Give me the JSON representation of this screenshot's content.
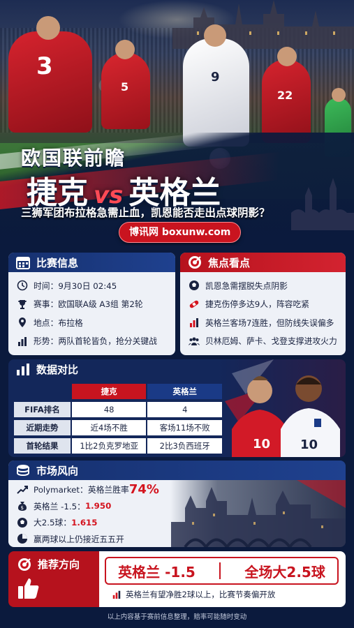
{
  "hero": {
    "kicker": "欧国联前瞻",
    "team_home": "捷克",
    "vs": "vs",
    "team_away": "英格兰",
    "tagline": "三狮军团布拉格急需止血，凯恩能否走出点球阴影？",
    "brand": "博讯网  boxunw.com",
    "jersey_numbers": [
      "3",
      "5",
      "9",
      "22",
      "10",
      "10"
    ]
  },
  "match_info": {
    "title": "比赛信息",
    "rows": [
      {
        "icon": "clock-icon",
        "label": "时间：",
        "value": "9月30日 02:45"
      },
      {
        "icon": "trophy-icon",
        "label": "赛事：",
        "value": "欧国联A级  A3组  第2轮"
      },
      {
        "icon": "location-pin-icon",
        "label": "地点：",
        "value": "布拉格"
      },
      {
        "icon": "bar-chart-icon",
        "label": "形势：",
        "value": "两队首轮皆负，抢分关键战"
      }
    ]
  },
  "focus": {
    "title": "焦点看点",
    "rows": [
      {
        "icon": "soccer-ball-icon",
        "text": "凯恩急需摆脱失点阴影"
      },
      {
        "icon": "bandage-icon",
        "text": "捷克伤停多达9人，阵容吃紧"
      },
      {
        "icon": "trend-bars-icon",
        "text": "英格兰客场7连胜，但防线失误偏多"
      },
      {
        "icon": "team-icon",
        "text": "贝林厄姆、萨卡、戈登支撑进攻火力"
      }
    ]
  },
  "compare": {
    "title": "数据对比",
    "headers": [
      "",
      "捷克",
      "英格兰"
    ],
    "rows": [
      [
        "FIFA排名",
        "48",
        "4"
      ],
      [
        "近期走势",
        "近4场不胜",
        "客场11场不败"
      ],
      [
        "首轮结果",
        "1比2负克罗地亚",
        "2比3负西班牙"
      ]
    ]
  },
  "market": {
    "title": "市场风向",
    "rows": [
      {
        "icon": "trend-line-icon",
        "text": "Polymarket：英格兰胜率 ",
        "highlight": "74%"
      },
      {
        "icon": "money-bag-icon",
        "text": "英格兰 -1.5： ",
        "highlight": "1.950"
      },
      {
        "icon": "soccer-ball-icon",
        "text": "大2.5球： ",
        "highlight": "1.615"
      },
      {
        "icon": "pie-chart-icon",
        "text": "赢两球以上仍接近五五开",
        "highlight": ""
      }
    ]
  },
  "recommend": {
    "title": "推荐方向",
    "pick1": "英格兰 -1.5",
    "pick2": "全场大2.5球",
    "note": "英格兰有望净胜2球以上，比赛节奏偏开放"
  },
  "footer": "以上内容基于赛前信息整理，赔率可能随时变动",
  "colors": {
    "navy": "#0b1a3d",
    "red": "#c8141f",
    "blue": "#1a3a86",
    "panel": "#eef1f7"
  }
}
